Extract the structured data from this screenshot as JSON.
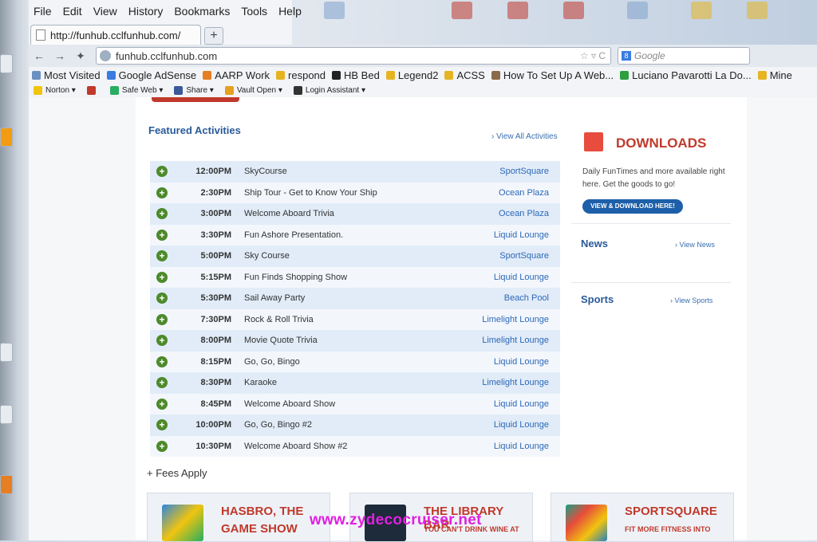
{
  "menu": [
    "File",
    "Edit",
    "View",
    "History",
    "Bookmarks",
    "Tools",
    "Help"
  ],
  "tab": {
    "title": "http://funhub.cclfunhub.com/",
    "new_tab_label": "+"
  },
  "nav": {
    "back": "←",
    "forward": "→",
    "url": "funhub.cclfunhub.com",
    "search_placeholder": "Google",
    "search_engine": "8"
  },
  "bookmarks": [
    {
      "label": "Most Visited",
      "color": "#6a8fc0"
    },
    {
      "label": "Google AdSense",
      "color": "#3a7be0"
    },
    {
      "label": "AARP Work",
      "color": "#e67e22"
    },
    {
      "label": "respond",
      "color": "#e6b422"
    },
    {
      "label": "HB Bed",
      "color": "#222222"
    },
    {
      "label": "Legend2",
      "color": "#e6b422"
    },
    {
      "label": "ACSS",
      "color": "#e6b422"
    },
    {
      "label": "How To Set Up A Web...",
      "color": "#8a6a4a"
    },
    {
      "label": "Luciano Pavarotti La Do...",
      "color": "#2e9e3e"
    },
    {
      "label": "Mine",
      "color": "#e6b422"
    }
  ],
  "toolbar2": [
    {
      "label": "Norton ▾",
      "color": "#f1c40f"
    },
    {
      "label": "",
      "color": "#c0392b"
    },
    {
      "label": "Safe Web ▾",
      "color": "#27ae60"
    },
    {
      "label": "Share ▾",
      "color": "#3b5998"
    },
    {
      "label": "Vault Open ▾",
      "color": "#e6a020"
    },
    {
      "label": "Login Assistant ▾",
      "color": "#333333"
    }
  ],
  "featured": {
    "title": "Featured Activities",
    "view_all": "› View All Activities",
    "activities": [
      {
        "time": "12:00PM",
        "name": "SkyCourse",
        "location": "SportSquare"
      },
      {
        "time": "2:30PM",
        "name": "Ship Tour - Get to Know Your Ship",
        "location": "Ocean Plaza"
      },
      {
        "time": "3:00PM",
        "name": "Welcome Aboard Trivia",
        "location": "Ocean Plaza"
      },
      {
        "time": "3:30PM",
        "name": "Fun Ashore Presentation.",
        "location": "Liquid Lounge"
      },
      {
        "time": "5:00PM",
        "name": "Sky Course",
        "location": "SportSquare"
      },
      {
        "time": "5:15PM",
        "name": "Fun Finds Shopping Show",
        "location": "Liquid Lounge"
      },
      {
        "time": "5:30PM",
        "name": "Sail Away Party",
        "location": "Beach Pool"
      },
      {
        "time": "7:30PM",
        "name": "Rock & Roll Trivia",
        "location": "Limelight Lounge"
      },
      {
        "time": "8:00PM",
        "name": "Movie Quote Trivia",
        "location": "Limelight Lounge"
      },
      {
        "time": "8:15PM",
        "name": "Go, Go, Bingo",
        "location": "Liquid Lounge"
      },
      {
        "time": "8:30PM",
        "name": "Karaoke",
        "location": "Limelight Lounge"
      },
      {
        "time": "8:45PM",
        "name": "Welcome Aboard Show",
        "location": "Liquid Lounge"
      },
      {
        "time": "10:00PM",
        "name": "Go, Go, Bingo #2",
        "location": "Liquid Lounge"
      },
      {
        "time": "10:30PM",
        "name": "Welcome Aboard Show #2",
        "location": "Liquid Lounge"
      }
    ],
    "fees_note": "+ Fees Apply"
  },
  "sidebar": {
    "downloads_title": "DOWNLOADS",
    "downloads_text": "Daily FunTimes and more available right here. Get the goods to go!",
    "downloads_button": "VIEW & DOWNLOAD HERE!",
    "news_title": "News",
    "news_link": "› View News",
    "sports_title": "Sports",
    "sports_link": "› View Sports"
  },
  "promos": [
    {
      "title": "HASBRO, THE",
      "title2": "GAME SHOW",
      "sub": ""
    },
    {
      "title": "THE LIBRARY BAR",
      "title2": "",
      "sub": "YOU CAN'T DRINK WINE AT"
    },
    {
      "title": "SPORTSQUARE",
      "title2": "",
      "sub": "FIT MORE FITNESS INTO"
    }
  ],
  "watermark": "www.zydecocruiser.net"
}
